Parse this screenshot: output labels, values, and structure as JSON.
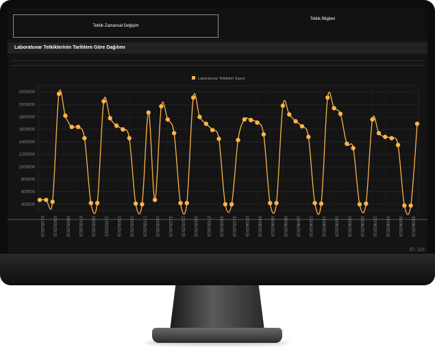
{
  "tabs": [
    {
      "label": "Tetkik Zamansal Değişim",
      "active": true
    },
    {
      "label": "Tetkik Bilgileri",
      "active": false
    }
  ],
  "panel": {
    "title": "Laboratuvar Tetkiklerinin Tarihlere Göre Dağılımı"
  },
  "page_id": "ID: 116",
  "colors": {
    "accent": "#ffb347",
    "background": "#141414"
  },
  "chart_data": {
    "type": "line",
    "title": "",
    "xlabel": "",
    "ylabel": "",
    "legend": {
      "entries": [
        "Laboratuvar Tetkikleri Sayısı"
      ],
      "placement": "top-center"
    },
    "ylim": [
      300000,
      2300000
    ],
    "yticks": [
      400000,
      600000,
      800000,
      1000000,
      1200000,
      1400000,
      1600000,
      1800000,
      2000000,
      2200000
    ],
    "grid": true,
    "x_tick_labels": [
      "01/05/2015",
      "03/05/2015",
      "05/05/2015",
      "07/05/2015",
      "09/05/2015",
      "11/05/2015",
      "13/05/2015",
      "15/05/2015",
      "17/05/2015",
      "19/05/2015",
      "21/05/2015",
      "23/05/2015",
      "25/05/2015",
      "27/05/2015",
      "29/05/2015",
      "31/05/2015",
      "02/06/2015",
      "04/06/2015",
      "06/06/2015",
      "08/06/2015",
      "10/06/2015",
      "12/06/2015",
      "14/06/2015",
      "16/06/2015",
      "18/06/2015",
      "20/06/2015",
      "22/06/2015",
      "24/06/2015",
      "26/06/2015",
      "28/06/2015"
    ],
    "series": [
      {
        "name": "Laboratuvar Tetkikleri Sayısı",
        "values": [
          470000,
          470000,
          440000,
          2170000,
          1820000,
          1640000,
          1640000,
          1460000,
          420000,
          420000,
          2050000,
          1780000,
          1660000,
          1600000,
          1460000,
          410000,
          400000,
          1870000,
          470000,
          1970000,
          1760000,
          1540000,
          420000,
          420000,
          2110000,
          1800000,
          1690000,
          1590000,
          1450000,
          400000,
          400000,
          1430000,
          1760000,
          1750000,
          1710000,
          1520000,
          420000,
          420000,
          1980000,
          1840000,
          1730000,
          1650000,
          1480000,
          420000,
          410000,
          2110000,
          1940000,
          1850000,
          1370000,
          1300000,
          400000,
          410000,
          1760000,
          1540000,
          1480000,
          1460000,
          1350000,
          380000,
          380000,
          1690000
        ]
      }
    ]
  }
}
